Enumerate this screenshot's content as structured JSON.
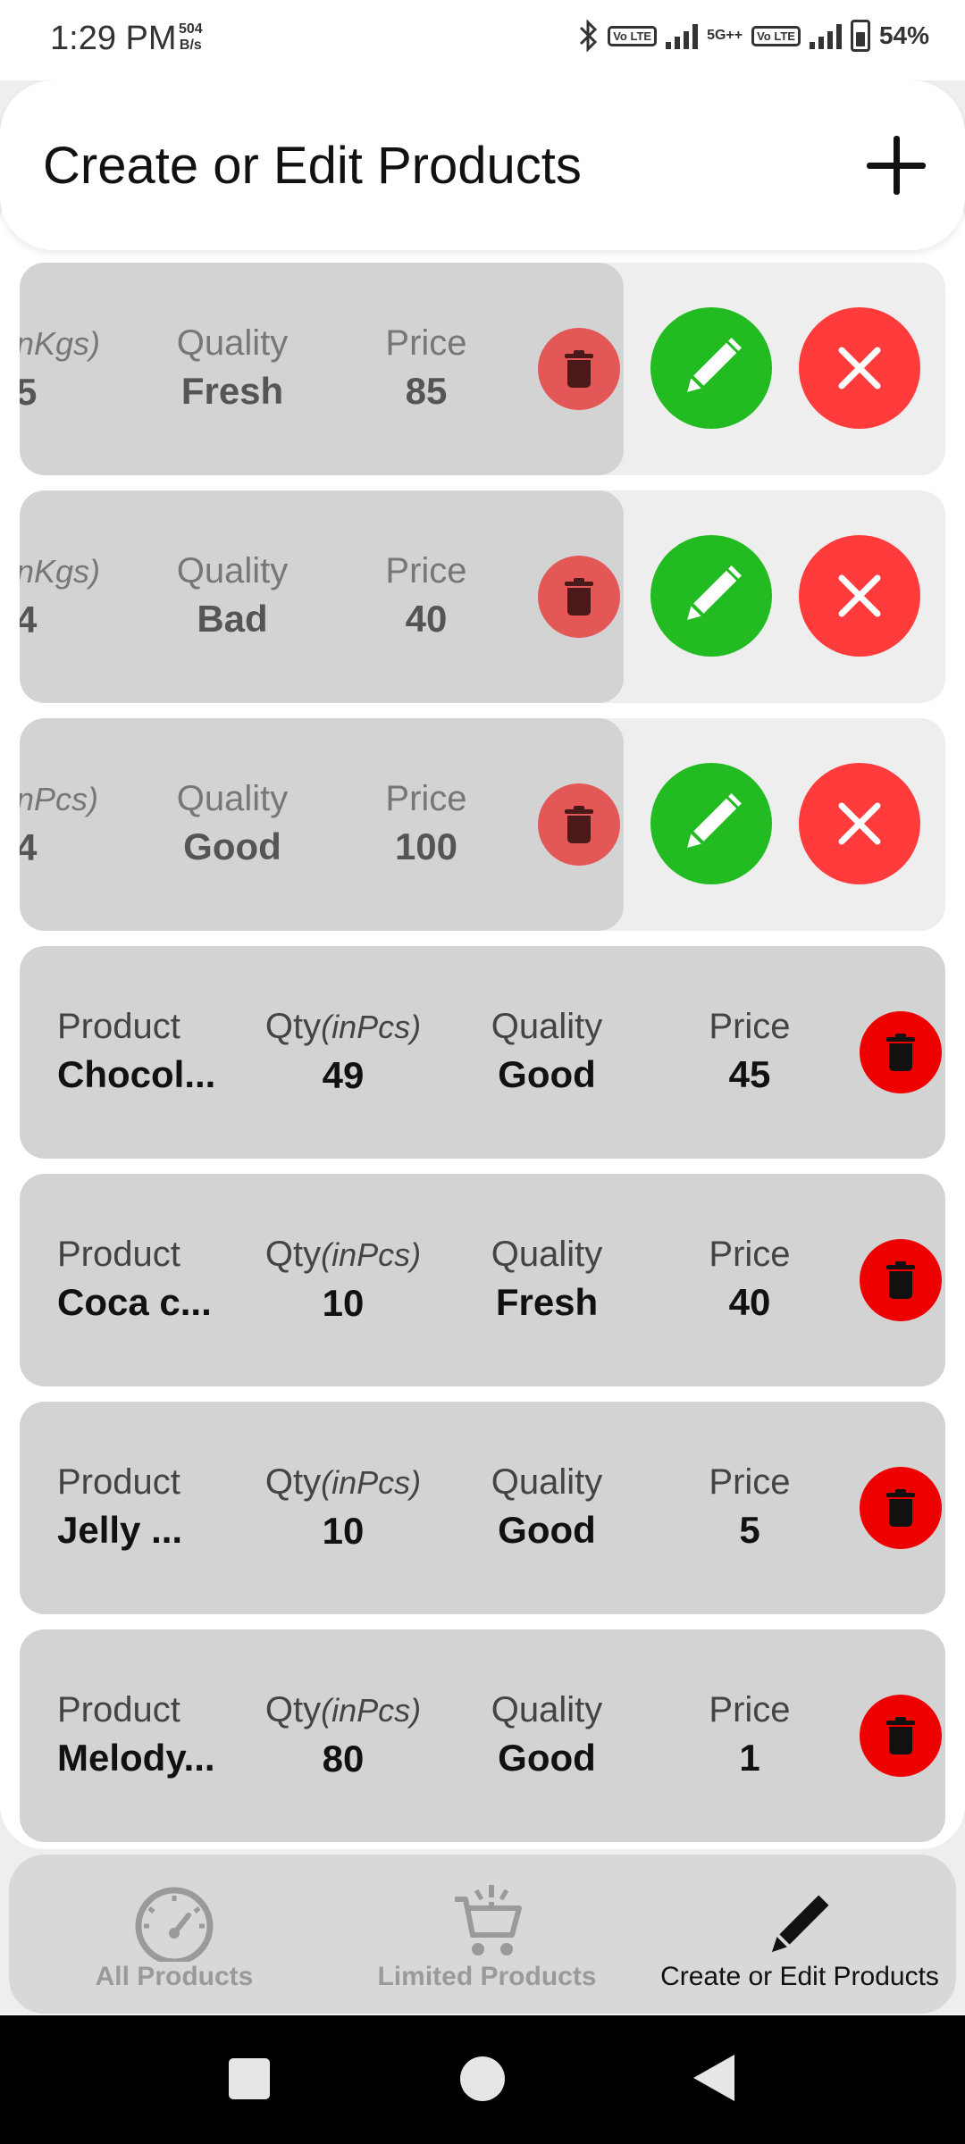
{
  "status_bar": {
    "time": "1:29 PM",
    "net_speed_value": "504",
    "net_speed_unit": "B/s",
    "battery": "54%",
    "volte1": "Vo LTE",
    "fiveg": "5G++",
    "volte2": "Vo LTE"
  },
  "header": {
    "title": "Create or Edit Products",
    "add_icon": "plus-icon"
  },
  "swiped_rows": [
    {
      "qty_label": "nKgs)",
      "qty": "5",
      "quality_label": "Quality",
      "quality": "Fresh",
      "price_label": "Price",
      "price": "85"
    },
    {
      "qty_label": "nKgs)",
      "qty": "4",
      "quality_label": "Quality",
      "quality": "Bad",
      "price_label": "Price",
      "price": "40"
    },
    {
      "qty_label": "nPcs)",
      "qty": "4",
      "quality_label": "Quality",
      "quality": "Good",
      "price_label": "Price",
      "price": "100"
    }
  ],
  "rows": [
    {
      "product_label": "Product",
      "product": "Chocol...",
      "qty_label": "Qty",
      "qty_unit": "(inPcs)",
      "qty": "49",
      "quality_label": "Quality",
      "quality": "Good",
      "price_label": "Price",
      "price": "45"
    },
    {
      "product_label": "Product",
      "product": "Coca c...",
      "qty_label": "Qty",
      "qty_unit": "(inPcs)",
      "qty": "10",
      "quality_label": "Quality",
      "quality": "Fresh",
      "price_label": "Price",
      "price": "40"
    },
    {
      "product_label": "Product",
      "product": "Jelly ...",
      "qty_label": "Qty",
      "qty_unit": "(inPcs)",
      "qty": "10",
      "quality_label": "Quality",
      "quality": "Good",
      "price_label": "Price",
      "price": "5"
    },
    {
      "product_label": "Product",
      "product": "Melody...",
      "qty_label": "Qty",
      "qty_unit": "(inPcs)",
      "qty": "80",
      "quality_label": "Quality",
      "quality": "Good",
      "price_label": "Price",
      "price": "1"
    }
  ],
  "bottom_nav": [
    {
      "label": "All Products",
      "icon": "speedometer-icon",
      "active": false
    },
    {
      "label": "Limited Products",
      "icon": "cart-icon",
      "active": false
    },
    {
      "label": "Create or Edit Products",
      "icon": "pencil-icon",
      "active": true
    }
  ],
  "colors": {
    "edit": "#22bb22",
    "close": "#ff3b3b",
    "delete": "#ee0000",
    "card": "#d3d3d3"
  }
}
